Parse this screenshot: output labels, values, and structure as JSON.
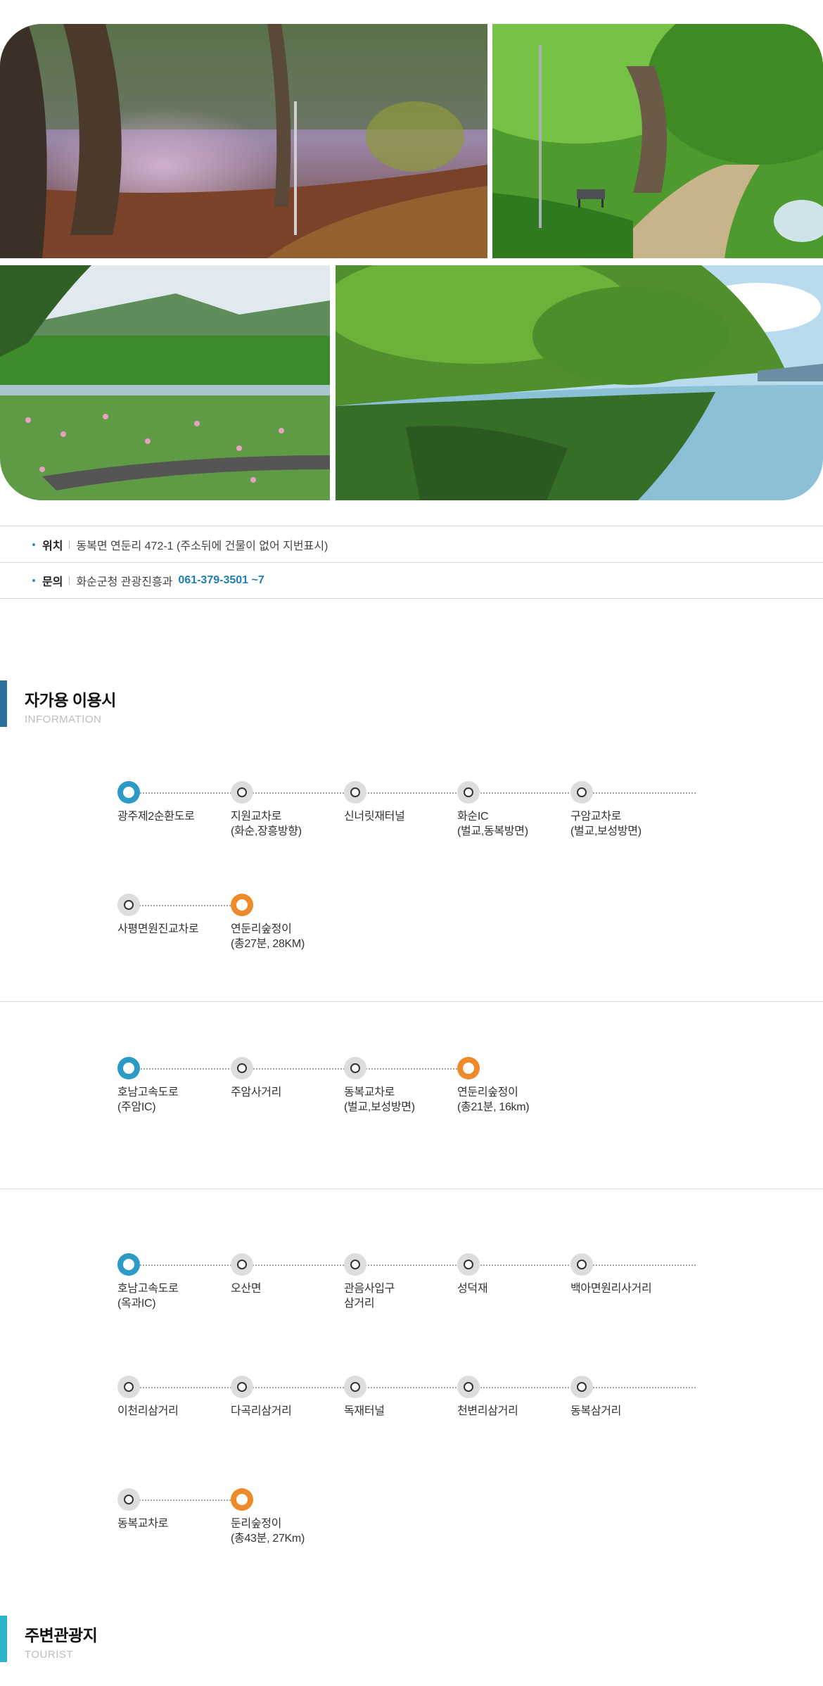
{
  "gallery": {
    "photos": [
      {
        "name": "foggy-forest-path-photo"
      },
      {
        "name": "green-tree-path-bench-photo"
      },
      {
        "name": "flower-field-river-photo"
      },
      {
        "name": "river-reflection-forest-photo"
      }
    ]
  },
  "info": {
    "location_label": "위치",
    "location_value": "동복면 연둔리 472-1 (주소뒤에 건물이 없어 지번표시)",
    "contact_label": "문의",
    "contact_value": "화순군청 관광진흥과",
    "contact_tel": "061-379-3501 ~7"
  },
  "section_car": {
    "title": "자가용 이용시",
    "subtitle": "INFORMATION"
  },
  "routes": [
    {
      "rows": [
        [
          "광주제2순환도로",
          "지원교차로\n(화순,장흥방향)",
          "신너릿재터널",
          "화순IC\n(벌교,동복방면)",
          "구암교차로\n(벌교,보성방면)"
        ],
        [
          "사평면원진교차로",
          "연둔리숲정이\n(총27분, 28KM)"
        ]
      ]
    },
    {
      "rows": [
        [
          "호남고속도로\n(주암IC)",
          "주암사거리",
          "동복교차로\n(벌교,보성방면)",
          "연둔리숲정이\n(총21분, 16km)"
        ]
      ]
    },
    {
      "rows": [
        [
          "호남고속도로\n(옥과IC)",
          "오산면",
          "관음사입구\n삼거리",
          "성덕재",
          "백아면원리사거리"
        ],
        [
          "이천리삼거리",
          "다곡리삼거리",
          "독재터널",
          "천변리삼거리",
          "동복삼거리"
        ],
        [
          "동복교차로",
          "둔리숲정이\n(총43분, 27Km)"
        ]
      ]
    }
  ],
  "section_tourist": {
    "title": "주변관광지",
    "subtitle": "TOURIST"
  },
  "colors": {
    "accent_blue": "#2b9ac7",
    "accent_orange": "#ee8a2a",
    "tel_blue": "#1f7fb8"
  }
}
